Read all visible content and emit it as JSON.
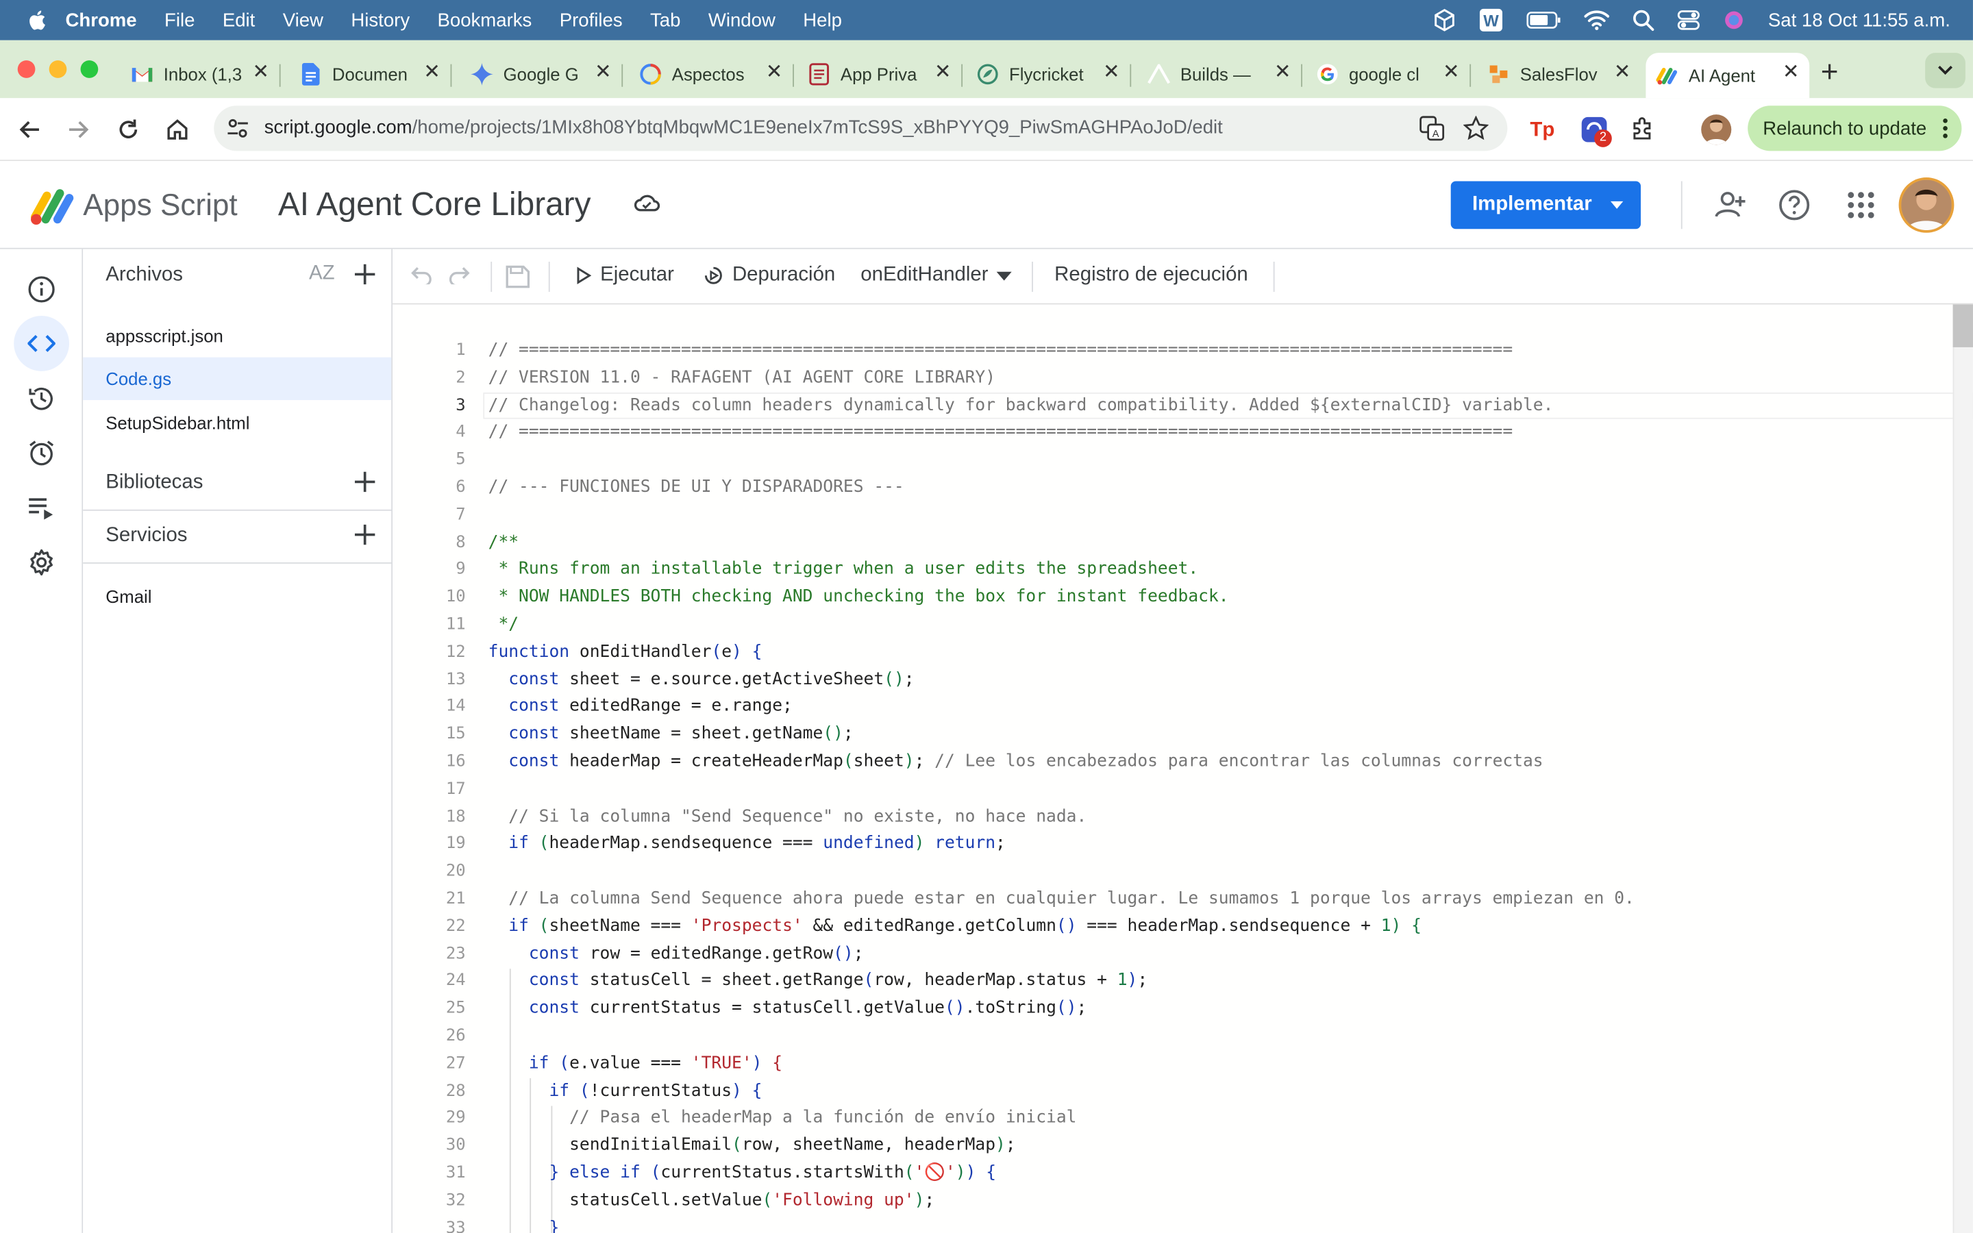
{
  "menubar": {
    "app": "Chrome",
    "items": [
      "File",
      "Edit",
      "View",
      "History",
      "Bookmarks",
      "Profiles",
      "Tab",
      "Window",
      "Help"
    ],
    "clock": "Sat 18 Oct  11:55 a.m."
  },
  "tabs": [
    {
      "title": "Inbox (1,3",
      "icon": "gmail-icon"
    },
    {
      "title": "Documen",
      "icon": "google-docs-icon"
    },
    {
      "title": "Google G",
      "icon": "gemini-icon"
    },
    {
      "title": "Aspectos",
      "icon": "google-cloud-icon"
    },
    {
      "title": "App Priva",
      "icon": "forms-icon"
    },
    {
      "title": "Flycricket",
      "icon": "flycricket-icon"
    },
    {
      "title": "Builds —",
      "icon": "builds-icon"
    },
    {
      "title": "google cl",
      "icon": "google-icon"
    },
    {
      "title": "SalesFlov",
      "icon": "salesflow-icon"
    },
    {
      "title": "AI Agent",
      "icon": "apps-script-icon",
      "active": true
    }
  ],
  "toolbar": {
    "url_domain": "script.google.com",
    "url_path": "/home/projects/1MIx8h08YbtqMbqwMC1E9eneIx7mTcS9S_xBhPYYQ9_PiwSmAGHPAoJoD/edit",
    "extension_badge": "2",
    "relaunch_label": "Relaunch to update"
  },
  "header": {
    "brand": "Apps Script",
    "project_title": "AI Agent Core Library",
    "deploy_label": "Implementar"
  },
  "files_panel": {
    "files_heading": "Archivos",
    "sort_label": "AZ",
    "files": [
      "appsscript.json",
      "Code.gs",
      "SetupSidebar.html"
    ],
    "active_file": "Code.gs",
    "libraries_heading": "Bibliotecas",
    "services_heading": "Servicios",
    "services": [
      "Gmail"
    ]
  },
  "editor_toolbar": {
    "run_label": "Ejecutar",
    "debug_label": "Depuración",
    "function_select": "onEditHandler",
    "log_label": "Registro de ejecución"
  },
  "editor": {
    "current_line": 3,
    "line_numbers": [
      "1",
      "2",
      "3",
      "4",
      "5",
      "6",
      "7",
      "8",
      "9",
      "10",
      "11",
      "12",
      "13",
      "14",
      "15",
      "16",
      "17",
      "18",
      "19",
      "20",
      "21",
      "22",
      "23",
      "24",
      "25",
      "26",
      "27",
      "28",
      "29",
      "30",
      "31",
      "32",
      "33"
    ]
  },
  "colors": {
    "menubar": "#3d6f9e",
    "tabstrip": "#dcecd5",
    "deploy_button": "#1a73e8",
    "relaunch_button": "#c6ebb3",
    "active_file_bg": "#e8f0fe"
  }
}
